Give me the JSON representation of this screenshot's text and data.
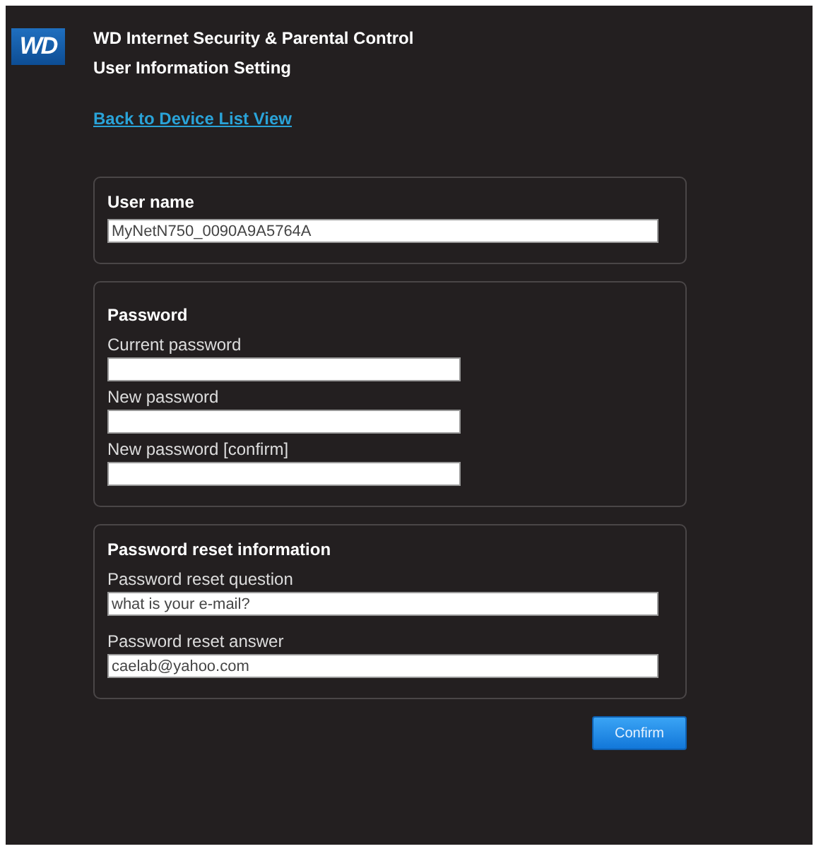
{
  "logo": "WD",
  "header": {
    "title": "WD Internet Security & Parental Control",
    "subtitle": "User Information Setting"
  },
  "back_link": "Back to Device List View",
  "sections": [
    {
      "title": "User name",
      "fields": [
        {
          "kind": "wide",
          "value": "MyNetN750_0090A9A5764A"
        }
      ]
    },
    {
      "title": "Password",
      "fields": [
        {
          "kind": "short",
          "label": "Current password"
        },
        {
          "kind": "short",
          "label": "New password"
        },
        {
          "kind": "short",
          "label": "New password [confirm]"
        }
      ]
    },
    {
      "title": "Password reset information",
      "fields": [
        {
          "kind": "wide",
          "label": "Password reset question",
          "value": "what is your e-mail?"
        },
        {
          "kind": "wide",
          "label": "Password reset answer",
          "value": "caelab@yahoo.com"
        }
      ]
    }
  ],
  "confirm_button": "Confirm"
}
